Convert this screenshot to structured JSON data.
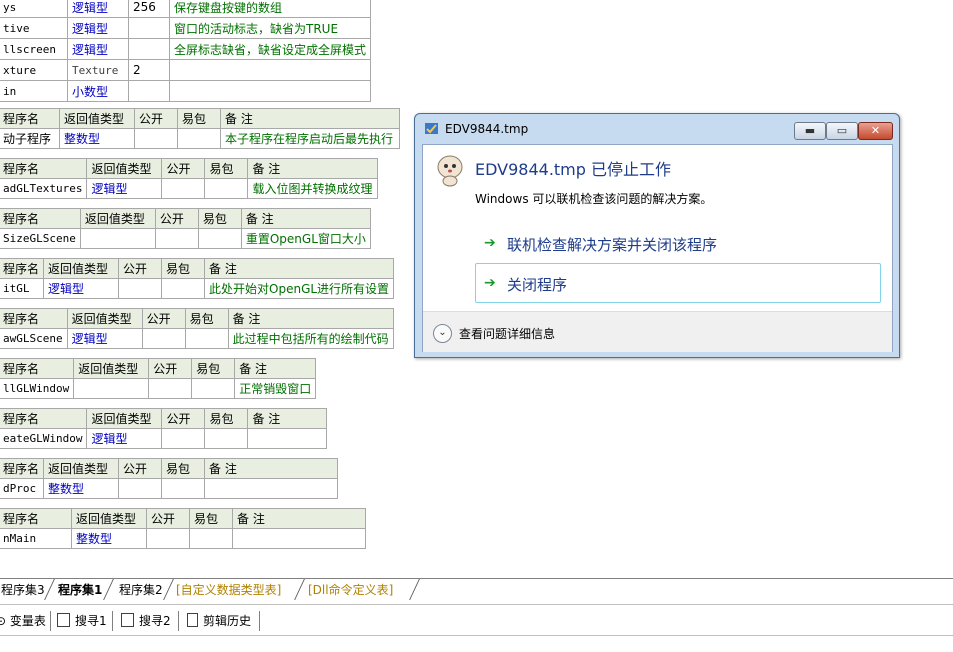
{
  "var_table": [
    {
      "name": "ys",
      "type": "逻辑型",
      "size": "256",
      "note": "保存键盘按键的数组"
    },
    {
      "name": "tive",
      "type": "逻辑型",
      "size": "",
      "note": "窗口的活动标志，缺省为TRUE"
    },
    {
      "name": "llscreen",
      "type": "逻辑型",
      "size": "",
      "note": "全屏标志缺省，缺省设定成全屏模式"
    },
    {
      "name": "xture",
      "type": "Texture",
      "size": "2",
      "note": ""
    },
    {
      "name": "in",
      "type": "小数型",
      "size": "",
      "note": ""
    }
  ],
  "header_labels": {
    "name": "程序名",
    "ret": "返回值类型",
    "pub": "公开",
    "easy": "易包",
    "note": "备 注"
  },
  "subs": [
    {
      "name": "动子程序",
      "type": "整数型",
      "note": "本子程序在程序启动后最先执行"
    },
    {
      "name": "adGLTextures",
      "type": "逻辑型",
      "note": "载入位图并转换成纹理"
    },
    {
      "name": "SizeGLScene",
      "type": "",
      "note": "重置OpenGL窗口大小"
    },
    {
      "name": "itGL",
      "type": "逻辑型",
      "note": "此处开始对OpenGL进行所有设置"
    },
    {
      "name": "awGLScene",
      "type": "逻辑型",
      "note": "此过程中包括所有的绘制代码"
    },
    {
      "name": "llGLWindow",
      "type": "",
      "note": "正常销毁窗口"
    },
    {
      "name": "eateGLWindow",
      "type": "逻辑型",
      "note": ""
    },
    {
      "name": "dProc",
      "type": "整数型",
      "note": ""
    },
    {
      "name": "nMain",
      "type": "整数型",
      "note": ""
    }
  ],
  "tabs": [
    {
      "label": "程序集3",
      "active": false,
      "special": false
    },
    {
      "label": "程序集1",
      "active": true,
      "special": false
    },
    {
      "label": "程序集2",
      "active": false,
      "special": false
    },
    {
      "label": "[自定义数据类型表]",
      "active": false,
      "special": true
    },
    {
      "label": "[Dll命令定义表]",
      "active": false,
      "special": true
    }
  ],
  "toolbar": [
    {
      "label": "变量表",
      "icon": "variable-icon"
    },
    {
      "label": "搜寻1",
      "icon": "search-window-icon"
    },
    {
      "label": "搜寻2",
      "icon": "search-window-icon"
    },
    {
      "label": "剪辑历史",
      "icon": "clipboard-icon"
    }
  ],
  "dialog": {
    "title": "EDV9844.tmp",
    "heading": "EDV9844.tmp 已停止工作",
    "subtitle": "Windows 可以联机检查该问题的解决方案。",
    "option1": "联机检查解决方案并关闭该程序",
    "option2": "关闭程序",
    "details": "查看问题详细信息"
  },
  "colors": {
    "type_blue": "#0000c0",
    "note_green": "#007000",
    "header_bg": "#e8efe0",
    "dialog_frame": "#c6daf0",
    "heading_blue": "#1e3c8a"
  }
}
